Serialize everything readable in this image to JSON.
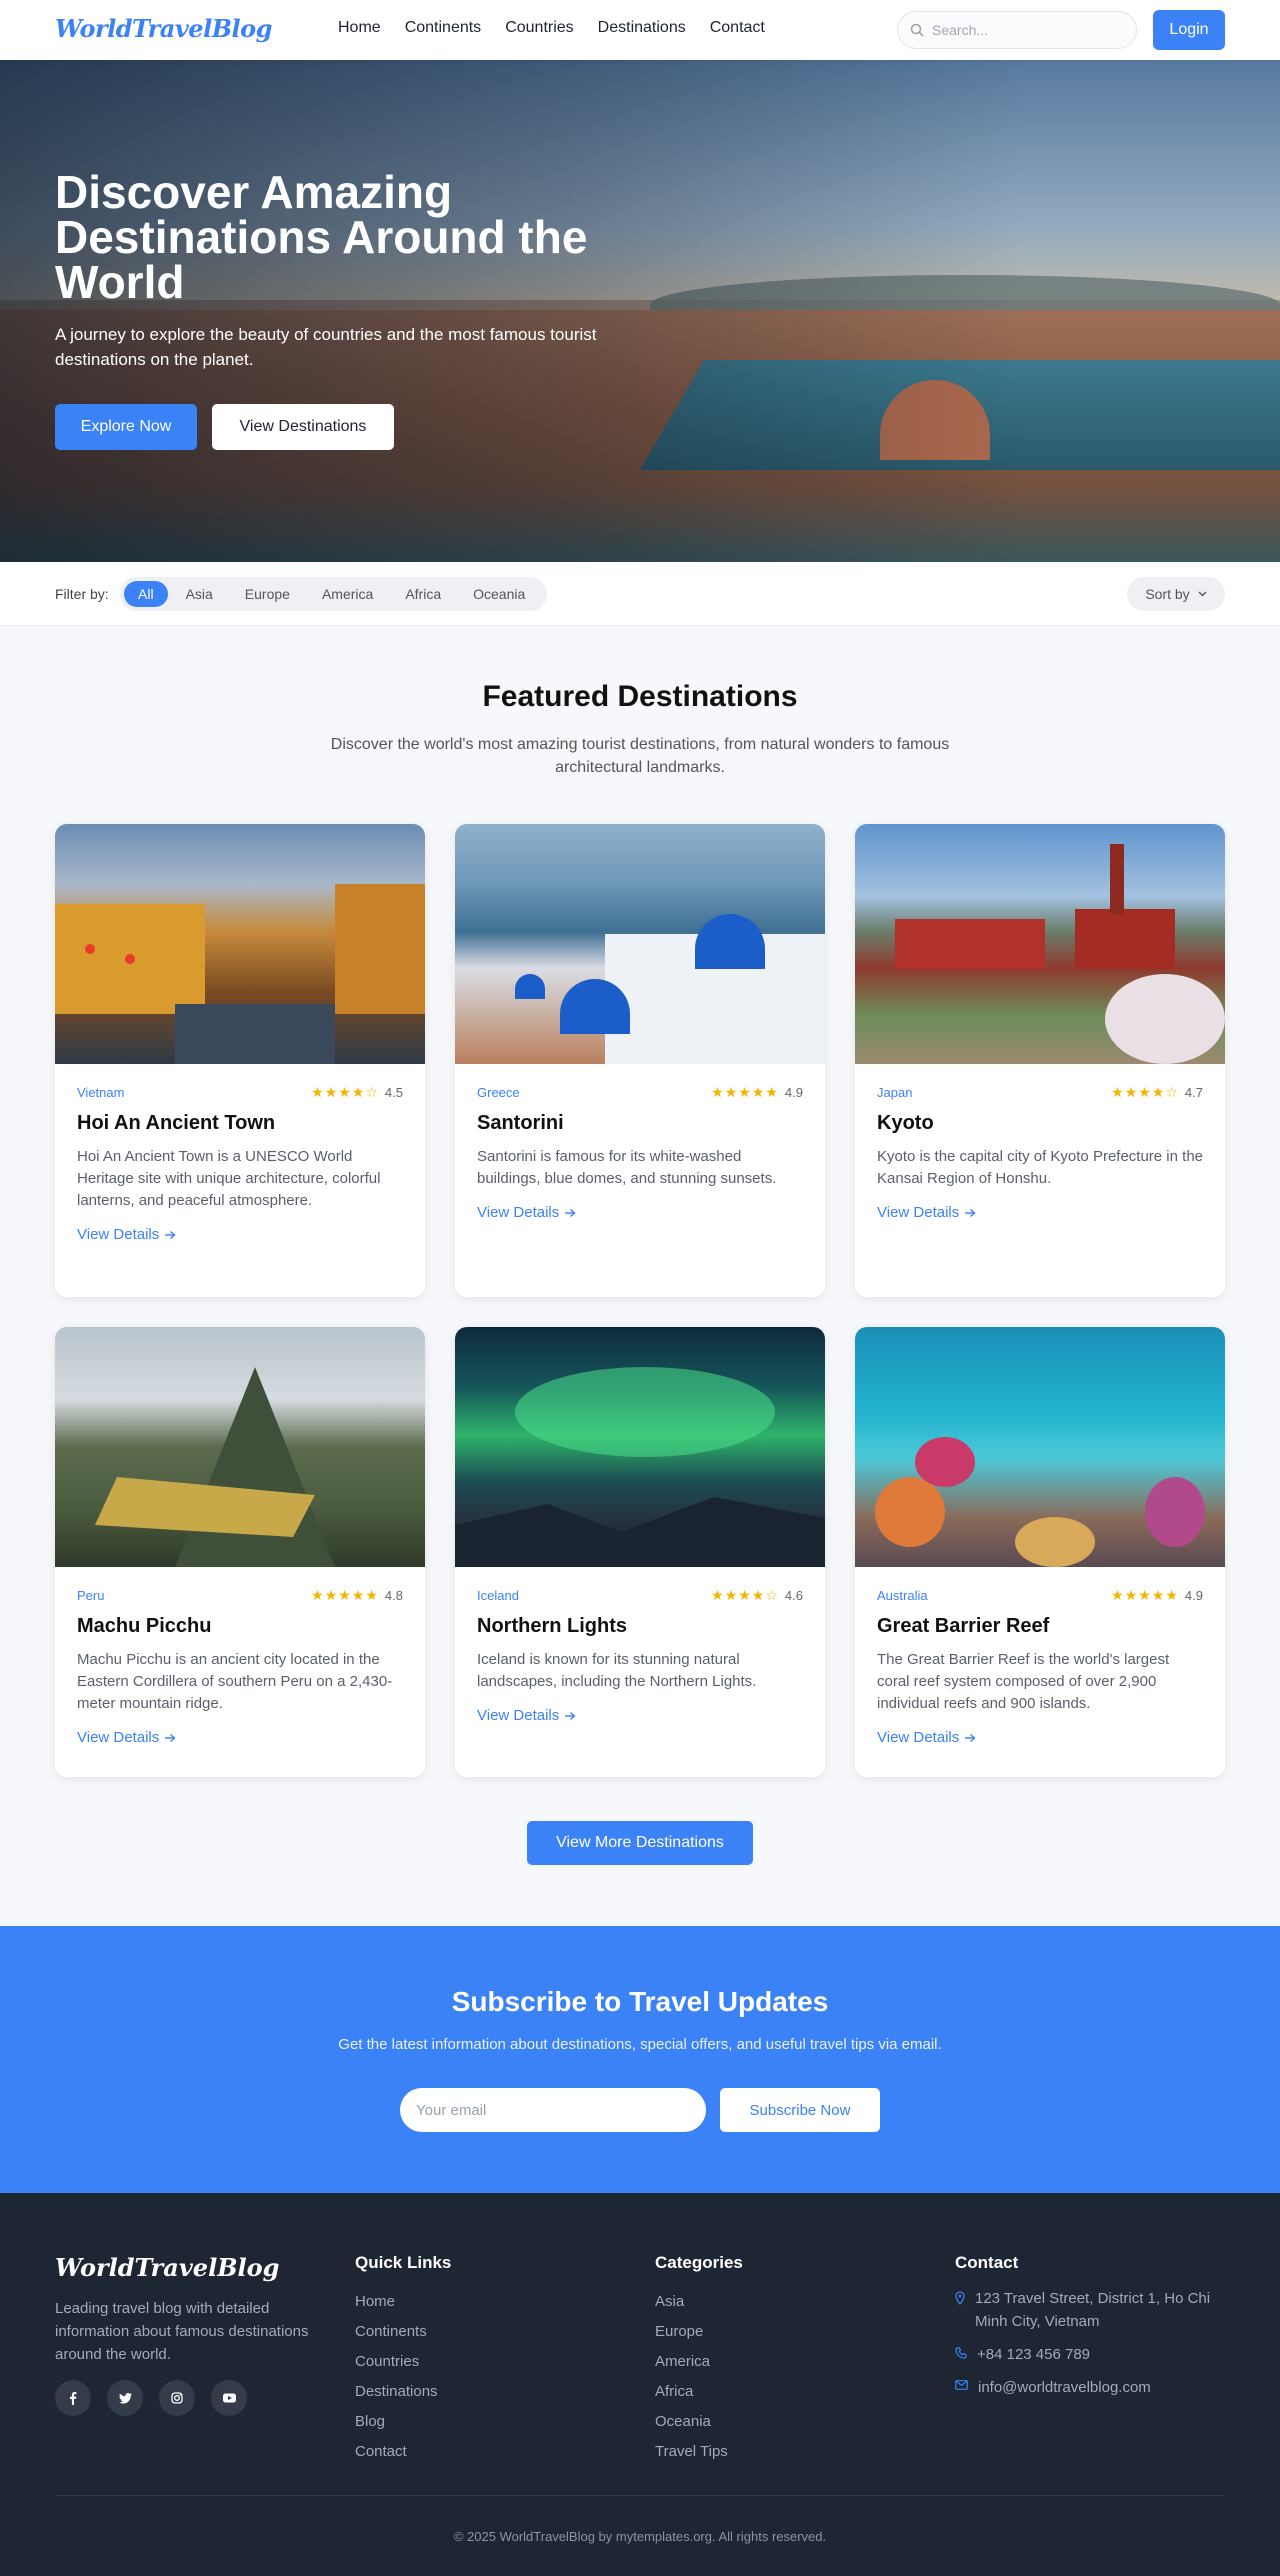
{
  "header": {
    "logo": "WorldTravelBlog",
    "nav": [
      "Home",
      "Continents",
      "Countries",
      "Destinations",
      "Contact"
    ],
    "search_placeholder": "Search...",
    "login_label": "Login"
  },
  "hero": {
    "title": "Discover Amazing Destinations Around the World",
    "subtitle": "A journey to explore the beauty of countries and the most famous tourist destinations on the planet.",
    "primary_button": "Explore Now",
    "secondary_button": "View Destinations"
  },
  "filter": {
    "label": "Filter by:",
    "options": [
      "All",
      "Asia",
      "Europe",
      "America",
      "Africa",
      "Oceania"
    ],
    "active": "All",
    "sort_label": "Sort by"
  },
  "featured": {
    "title": "Featured Destinations",
    "subtitle": "Discover the world's most amazing tourist destinations, from natural wonders to famous architectural landmarks.",
    "cards": [
      {
        "country": "Vietnam",
        "rating": "4.5",
        "rating_value": 4.5,
        "title": "Hoi An Ancient Town",
        "description": "Hoi An Ancient Town is a UNESCO World Heritage site with unique architecture, colorful lanterns, and peaceful atmosphere.",
        "link": "View Details"
      },
      {
        "country": "Greece",
        "rating": "4.9",
        "rating_value": 4.9,
        "title": "Santorini",
        "description": "Santorini is famous for its white-washed buildings, blue domes, and stunning sunsets.",
        "link": "View Details"
      },
      {
        "country": "Japan",
        "rating": "4.7",
        "rating_value": 4.7,
        "title": "Kyoto",
        "description": "Kyoto is the capital city of Kyoto Prefecture in the Kansai Region of Honshu.",
        "link": "View Details"
      },
      {
        "country": "Peru",
        "rating": "4.8",
        "rating_value": 4.8,
        "title": "Machu Picchu",
        "description": "Machu Picchu is an ancient city located in the Eastern Cordillera of southern Peru on a 2,430-meter mountain ridge.",
        "link": "View Details"
      },
      {
        "country": "Iceland",
        "rating": "4.6",
        "rating_value": 4.6,
        "title": "Northern Lights",
        "description": "Iceland is known for its stunning natural landscapes, including the Northern Lights.",
        "link": "View Details"
      },
      {
        "country": "Australia",
        "rating": "4.9",
        "rating_value": 4.9,
        "title": "Great Barrier Reef",
        "description": "The Great Barrier Reef is the world's largest coral reef system composed of over 2,900 individual reefs and 900 islands.",
        "link": "View Details"
      }
    ],
    "more_button": "View More Destinations"
  },
  "subscribe": {
    "title": "Subscribe to Travel Updates",
    "text": "Get the latest information about destinations, special offers, and useful travel tips via email.",
    "email_placeholder": "Your email",
    "button": "Subscribe Now"
  },
  "footer": {
    "logo": "WorldTravelBlog",
    "description": "Leading travel blog with detailed information about famous destinations around the world.",
    "socials": [
      "facebook-icon",
      "twitter-icon",
      "instagram-icon",
      "youtube-icon"
    ],
    "quick_links": {
      "title": "Quick Links",
      "items": [
        "Home",
        "Continents",
        "Countries",
        "Destinations",
        "Blog",
        "Contact"
      ]
    },
    "categories": {
      "title": "Categories",
      "items": [
        "Asia",
        "Europe",
        "America",
        "Africa",
        "Oceania",
        "Travel Tips"
      ]
    },
    "contact": {
      "title": "Contact",
      "address": "123 Travel Street, District 1, Ho Chi Minh City, Vietnam",
      "phone": "+84 123 456 789",
      "email": "info@worldtravelblog.com"
    },
    "copyright": "© 2025 WorldTravelBlog by mytemplates.org. All rights reserved."
  },
  "colors": {
    "accent": "#3b82f6",
    "footer_bg": "#1e2533",
    "star": "#f5b400"
  }
}
